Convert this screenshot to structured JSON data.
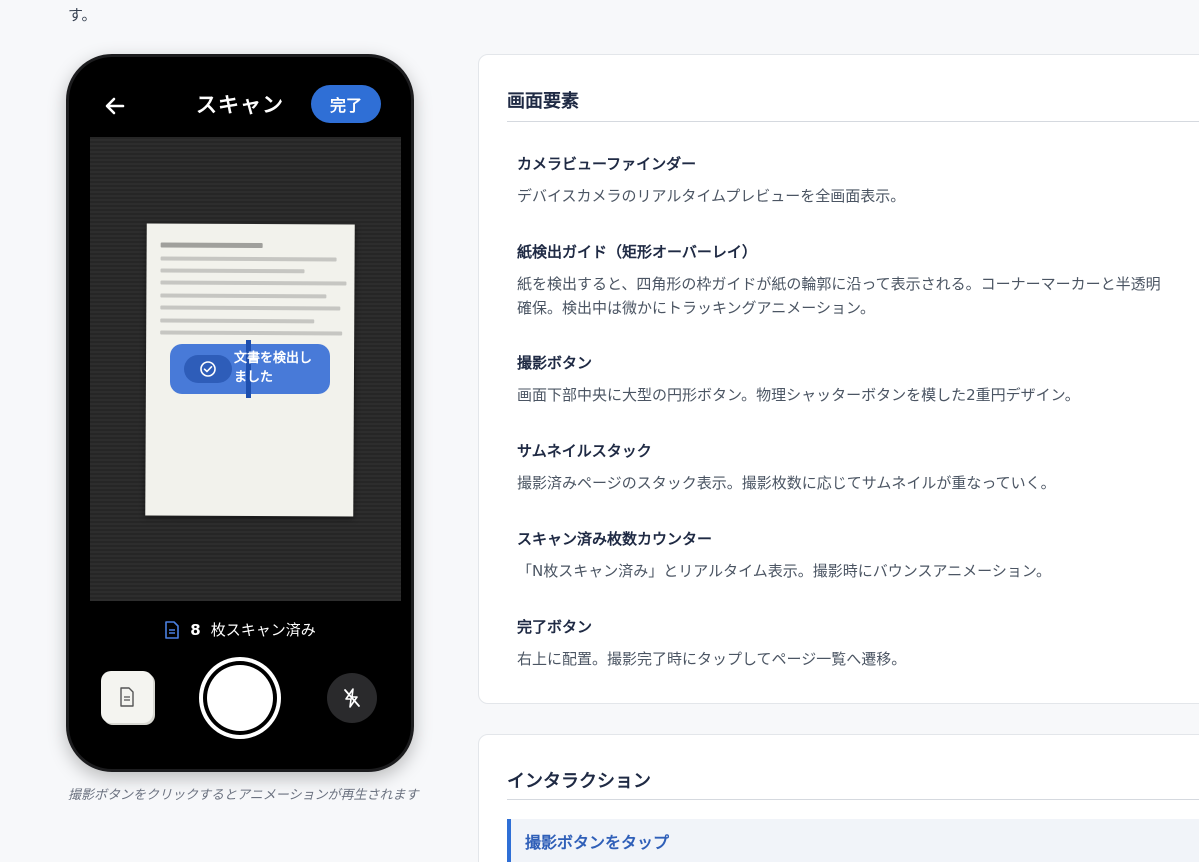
{
  "top_fragment": "す。",
  "phone": {
    "title": "スキャン",
    "done_label": "完了",
    "detect_text": "文書を検出しました",
    "counter_number": "8",
    "counter_label": "枚スキャン済み"
  },
  "caption": "撮影ボタンをクリックするとアニメーションが再生されます",
  "elements_card": {
    "title": "画面要素",
    "items": [
      {
        "name": "カメラビューファインダー",
        "desc": "デバイスカメラのリアルタイムプレビューを全画面表示。"
      },
      {
        "name": "紙検出ガイド（矩形オーバーレイ）",
        "desc": "紙を検出すると、四角形の枠ガイドが紙の輪郭に沿って表示される。コーナーマーカーと半透明\n確保。検出中は微かにトラッキングアニメーション。"
      },
      {
        "name": "撮影ボタン",
        "desc": "画面下部中央に大型の円形ボタン。物理シャッターボタンを模した2重円デザイン。"
      },
      {
        "name": "サムネイルスタック",
        "desc": "撮影済みページのスタック表示。撮影枚数に応じてサムネイルが重なっていく。"
      },
      {
        "name": "スキャン済み枚数カウンター",
        "desc": "「N枚スキャン済み」とリアルタイム表示。撮影時にバウンスアニメーション。"
      },
      {
        "name": "完了ボタン",
        "desc": "右上に配置。撮影完了時にタップしてページ一覧へ遷移。"
      }
    ]
  },
  "interaction_card": {
    "title": "インタラクション",
    "items": [
      {
        "label": "撮影ボタンをタップ"
      }
    ]
  },
  "colors": {
    "accent": "#2f6fd6",
    "phone_bg": "#000000",
    "page_bg": "#f7f8fa"
  },
  "icons": [
    "back-arrow-icon",
    "check-circle-icon",
    "document-icon",
    "flash-off-icon"
  ]
}
